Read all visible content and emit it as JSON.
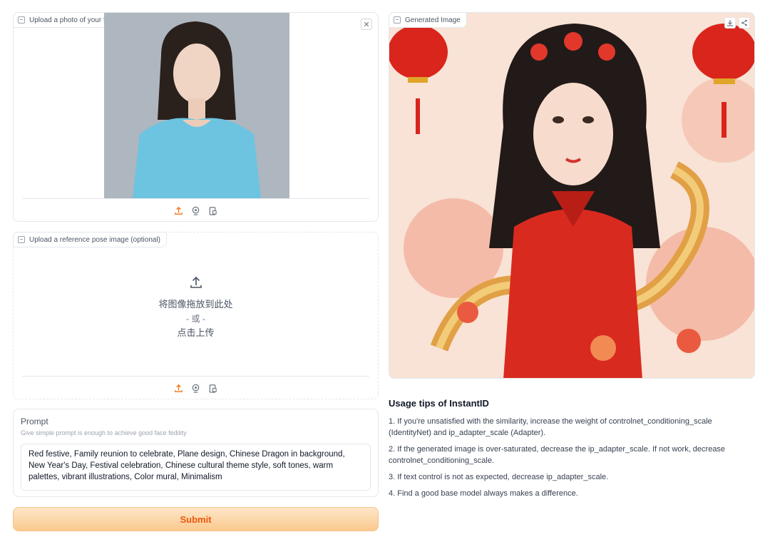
{
  "face_upload": {
    "label": "Upload a photo of your face"
  },
  "pose_upload": {
    "label": "Upload a reference pose image (optional)",
    "drop_text": "将图像拖放到此处",
    "or_text": "- 或 -",
    "click_text": "点击上传"
  },
  "prompt": {
    "label": "Prompt",
    "info": "Give simple prompt is enough to achieve good face fedility",
    "value": "Red festive, Family reunion to celebrate, Plane design, Chinese Dragon in background, New Year's Day, Festival celebration, Chinese cultural theme style, soft tones, warm palettes, vibrant illustrations, Color mural, Minimalism"
  },
  "submit_label": "Submit",
  "output": {
    "label": "Generated Image"
  },
  "tips": {
    "title": "Usage tips of InstantID",
    "items": [
      "1. If you're unsatisfied with the similarity, increase the weight of controlnet_conditioning_scale (IdentityNet) and ip_adapter_scale (Adapter).",
      "2. If the generated image is over-saturated, decrease the ip_adapter_scale. If not work, decrease controlnet_conditioning_scale.",
      "3. If text control is not as expected, decrease ip_adapter_scale.",
      "4. Find a good base model always makes a difference."
    ]
  },
  "colors": {
    "accent": "#f97316",
    "submit_text": "#ea580c"
  }
}
